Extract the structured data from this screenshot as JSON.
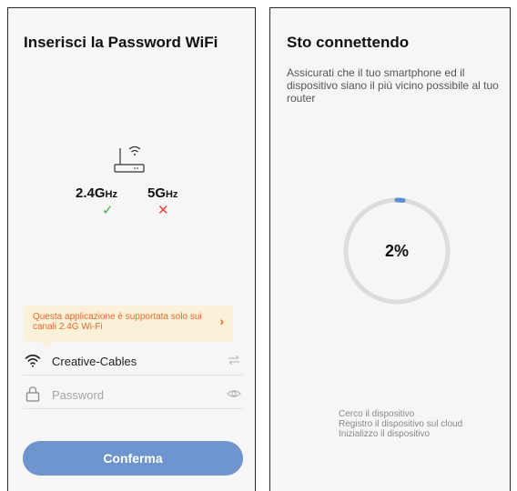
{
  "left_screen": {
    "title": "Inserisci la Password WiFi",
    "band_24": {
      "value": "2.4G",
      "unit": "Hz"
    },
    "band_5": {
      "value": "5G",
      "unit": "Hz"
    },
    "band_24_supported_mark": "✓",
    "band_5_supported_mark": "✕",
    "tip": "Questa applicazione è supportata solo sui canali 2.4G Wi-Fi",
    "tip_chevron": "›",
    "network_name": "Creative-Cables",
    "password_placeholder": "Password",
    "confirm_label": "Conferma",
    "icons": {
      "router": "router-icon",
      "wifi": "wifi-icon",
      "switch": "swap-arrows-icon",
      "lock": "lock-icon",
      "eye": "eye-icon"
    }
  },
  "right_screen": {
    "title": "Sto connettendo",
    "subtitle": "Assicurati che il tuo smartphone ed il dispositivo siano il più vicino possibile al tuo router",
    "progress_percent": 2,
    "progress_label": "2%",
    "steps": [
      "Cerco il dispositivo",
      "Registro il dispositivo sul cloud",
      "Inizializzo il dispositivo"
    ]
  },
  "colors": {
    "accent": "#6f95cf",
    "check_green": "#3bb54a",
    "cross_red": "#e8443a",
    "tip_text": "#e8692b",
    "tip_background": "#fbf0d8",
    "progress_track": "#dcdcdc",
    "progress_fill": "#5a8fd4"
  }
}
